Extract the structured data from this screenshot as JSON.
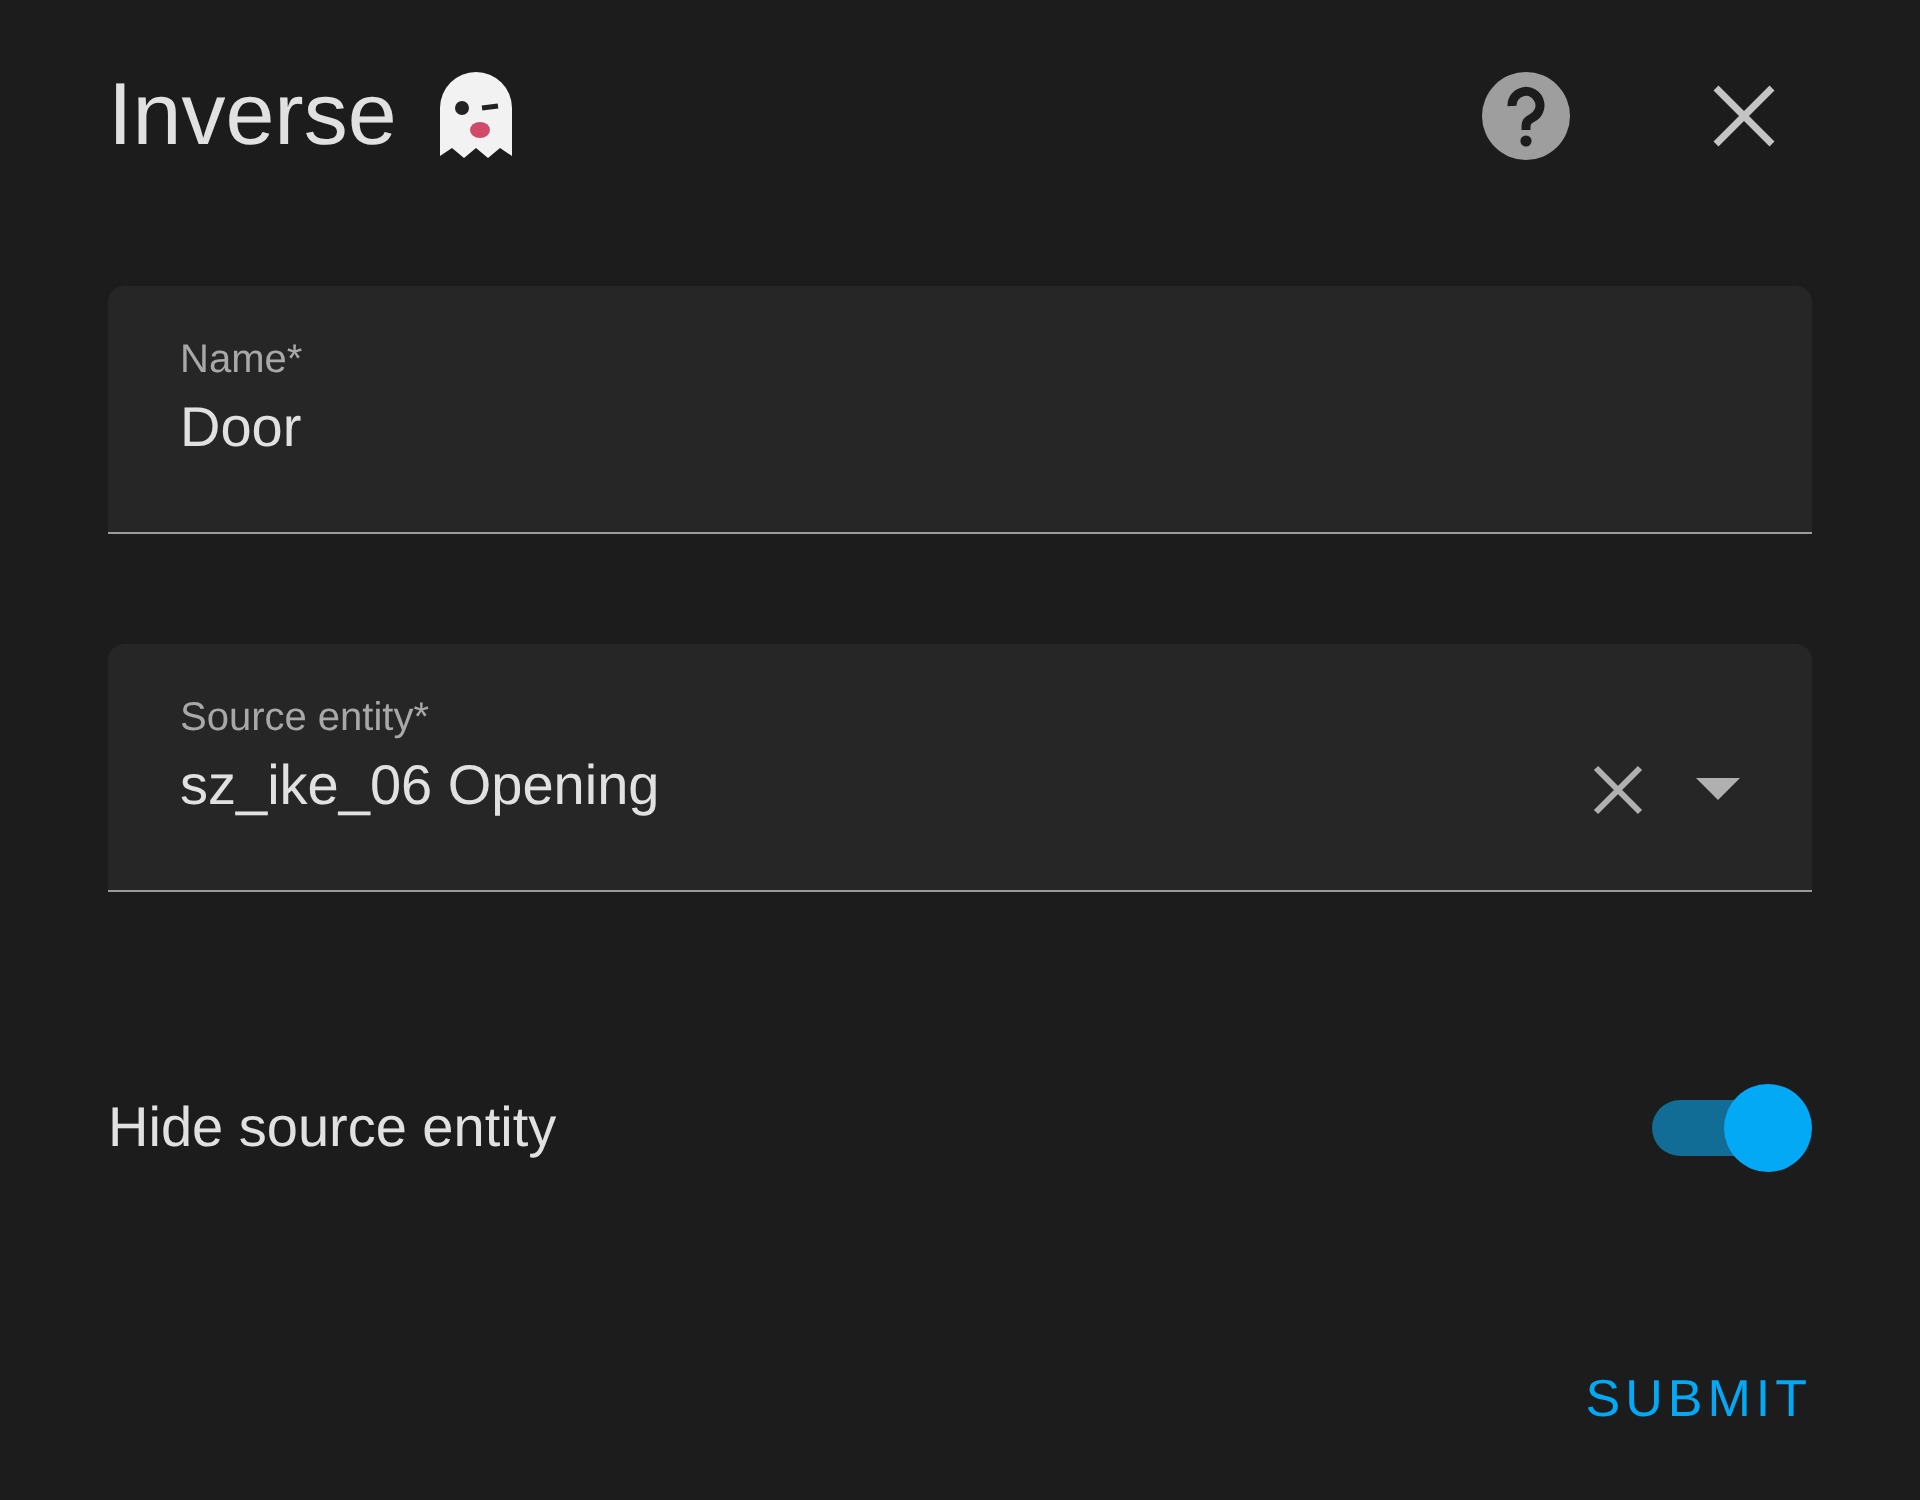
{
  "dialog": {
    "title": "Inverse"
  },
  "fields": [
    {
      "kind": "text",
      "label": "Name*",
      "value": "Door"
    },
    {
      "kind": "select",
      "label": "Source entity*",
      "value": "sz_ike_06 Opening"
    }
  ],
  "toggle": {
    "label": "Hide source entity",
    "on": true
  },
  "buttons": [
    "SUBMIT"
  ]
}
